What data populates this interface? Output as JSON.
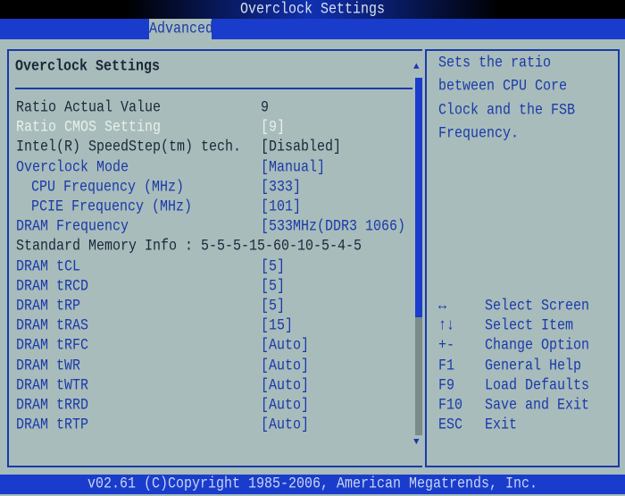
{
  "window": {
    "title": "Overclock Settings"
  },
  "tabs": [
    {
      "label": "Advanced",
      "active": true
    }
  ],
  "panel": {
    "title": "Overclock Settings"
  },
  "rows": [
    {
      "label": "Ratio Actual Value",
      "value": "9",
      "style": "dark"
    },
    {
      "label": "Ratio CMOS Setting",
      "value": "[9]",
      "style": "sel"
    },
    {
      "label": "Intel(R) SpeedStep(tm) tech.",
      "value": "[Disabled]",
      "style": "dark"
    },
    {
      "label": "Overclock Mode",
      "value": "[Manual]",
      "style": "blue"
    },
    {
      "label": "CPU Frequency (MHz)",
      "value": "[333]",
      "style": "blue",
      "indent": true
    },
    {
      "label": "PCIE Frequency (MHz)",
      "value": "[101]",
      "style": "blue",
      "indent": true
    },
    {
      "label": "DRAM Frequency",
      "value": "[533MHz(DDR3 1066) ]",
      "style": "blue"
    },
    {
      "label": "Standard Memory Info : 5-5-5-15-60-10-5-4-5",
      "value": "",
      "style": "dark"
    },
    {
      "label": "DRAM tCL",
      "value": "[5]",
      "style": "blue"
    },
    {
      "label": "DRAM tRCD",
      "value": "[5]",
      "style": "blue"
    },
    {
      "label": "DRAM tRP",
      "value": "[5]",
      "style": "blue"
    },
    {
      "label": "DRAM tRAS",
      "value": "[15]",
      "style": "blue"
    },
    {
      "label": "DRAM tRFC",
      "value": "[Auto]",
      "style": "blue"
    },
    {
      "label": "DRAM tWR",
      "value": "[Auto]",
      "style": "blue"
    },
    {
      "label": "DRAM tWTR",
      "value": "[Auto]",
      "style": "blue"
    },
    {
      "label": "DRAM tRRD",
      "value": "[Auto]",
      "style": "blue"
    },
    {
      "label": "DRAM tRTP",
      "value": "[Auto]",
      "style": "blue"
    }
  ],
  "scrollbar": {
    "up_icon": "▲",
    "down_icon": "▼"
  },
  "help": {
    "text": "Sets the ratio\nbetween CPU Core\nClock and the FSB\nFrequency."
  },
  "keys": [
    {
      "key": "↔",
      "desc": "Select Screen"
    },
    {
      "key": "↑↓",
      "desc": "Select Item"
    },
    {
      "key": "+-",
      "desc": "Change Option"
    },
    {
      "key": "F1",
      "desc": "General Help"
    },
    {
      "key": "F9",
      "desc": "Load Defaults"
    },
    {
      "key": "F10",
      "desc": "Save and Exit"
    },
    {
      "key": "ESC",
      "desc": "Exit"
    }
  ],
  "footer": {
    "text": "v02.61 (C)Copyright 1985-2006, American Megatrends, Inc."
  },
  "colors": {
    "background": "#a8bcbc",
    "accent": "#1a3ccc",
    "item_text": "#1a3aa8",
    "selected_text": "#e8f0e8"
  }
}
